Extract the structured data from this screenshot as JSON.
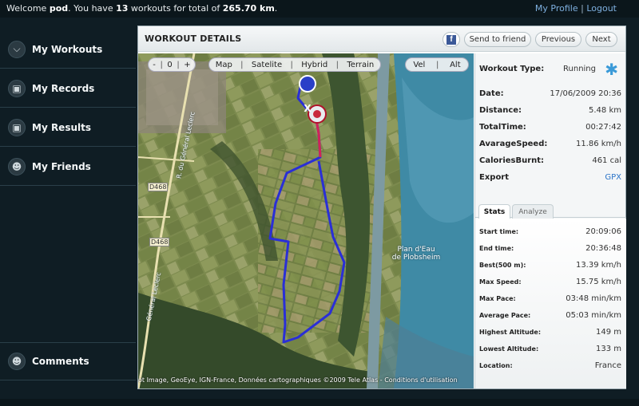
{
  "header": {
    "welcome_prefix": "Welcome ",
    "user": "pod",
    "mid": ". You have ",
    "workout_count": "13",
    "mid2": " workouts for total of ",
    "total_distance": "265.70 km",
    "suffix": ".",
    "my_profile": "My Profile",
    "separator": "|",
    "logout": "Logout"
  },
  "sidebar": {
    "items": [
      {
        "label": "My Workouts",
        "icon": "shoe-icon"
      },
      {
        "label": "My Records",
        "icon": "records-icon"
      },
      {
        "label": "My Results",
        "icon": "results-icon"
      },
      {
        "label": "My Friends",
        "icon": "person-icon"
      }
    ],
    "comments": {
      "label": "Comments",
      "icon": "person-icon"
    }
  },
  "workout": {
    "title": "WORKOUT DETAILS",
    "buttons": {
      "facebook": "f",
      "send_to_friend": "Send to friend",
      "previous": "Previous",
      "next": "Next"
    }
  },
  "map": {
    "zoom_out": "-",
    "zoom_level": "0",
    "zoom_in": "+",
    "types": [
      "Map",
      "Satelite",
      "Hybrid",
      "Terrain"
    ],
    "overlays": [
      "Vel",
      "Alt"
    ],
    "place": "Plan d'Eau\nde Plobsheim",
    "road_a": "D468",
    "road_b": "D468",
    "street_1": "R. du Général Leclerc",
    "street_2": "Général Leclerc",
    "copyright": "ot Image, GeoEye, IGN-France, Données cartographiques ©2009 Tele Atlas - Conditions d'utilisation",
    "start_marker": "X"
  },
  "summary": {
    "workout_type_label": "Workout Type:",
    "workout_type": "Running",
    "rows": [
      {
        "label": "Date:",
        "value": "17/06/2009 20:36"
      },
      {
        "label": "Distance:",
        "value": "5.48 km"
      },
      {
        "label": "TotalTime:",
        "value": "00:27:42"
      },
      {
        "label": "AvarageSpeed:",
        "value": "11.86 km/h"
      },
      {
        "label": "CaloriesBurnt:",
        "value": "461 cal"
      }
    ],
    "export_label": "Export",
    "export_value": "GPX"
  },
  "tabs": {
    "stats": "Stats",
    "analyze": "Analyze"
  },
  "stats": [
    {
      "label": "Start time:",
      "value": "20:09:06"
    },
    {
      "label": "End time:",
      "value": "20:36:48"
    },
    {
      "label": "Best(500 m):",
      "value": "13.39 km/h"
    },
    {
      "label": "Max Speed:",
      "value": "15.75 km/h"
    },
    {
      "label": "Max Pace:",
      "value": "03:48 min/km"
    },
    {
      "label": "Average Pace:",
      "value": "05:03 min/km"
    },
    {
      "label": "Highest Altitude:",
      "value": "149 m"
    },
    {
      "label": "Lowest Altitude:",
      "value": "133 m"
    },
    {
      "label": "Location:",
      "value": "France"
    }
  ]
}
